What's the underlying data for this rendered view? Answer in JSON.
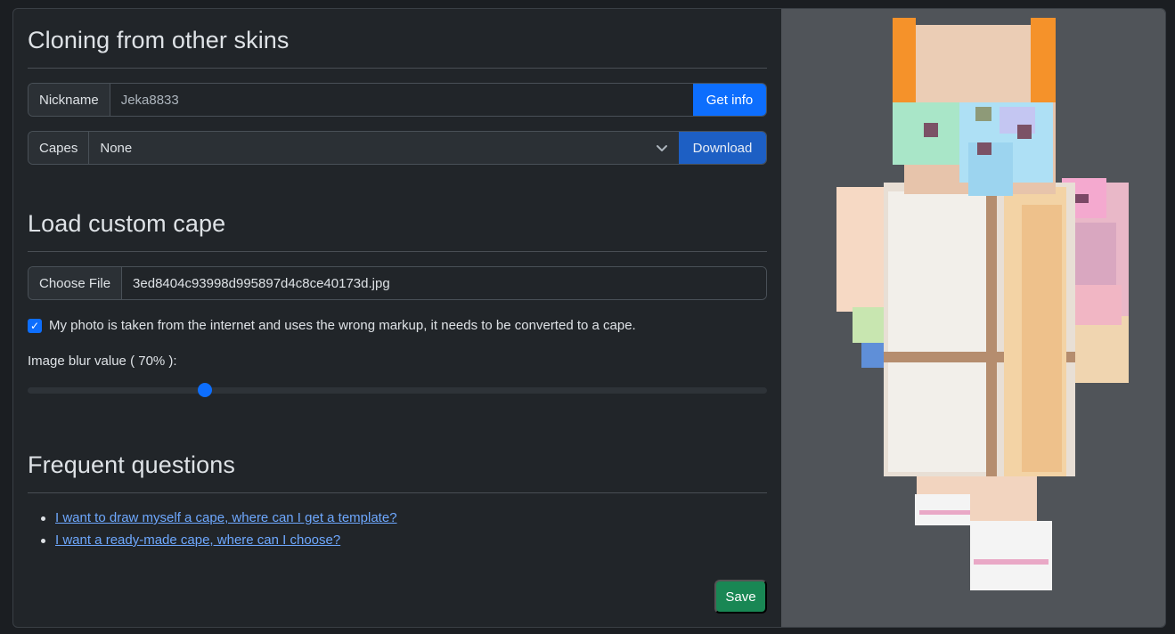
{
  "clone": {
    "heading": "Cloning from other skins",
    "nickname_label": "Nickname",
    "nickname_value": "Jeka8833",
    "get_info_label": "Get info",
    "capes_label": "Capes",
    "capes_selected": "None",
    "download_label": "Download"
  },
  "custom": {
    "heading": "Load custom cape",
    "choose_file_label": "Choose File",
    "file_name": "3ed8404c93998d995897d4c8ce40173d.jpg",
    "checkbox_label": "My photo is taken from the internet and uses the wrong markup, it needs to be converted to a cape.",
    "checkbox_checked": true,
    "blur_label": "Image blur value ( 70% ):",
    "blur_value_percent": 70,
    "blur_slider_position_fraction": 0.24
  },
  "faq": {
    "heading": "Frequent questions",
    "links": [
      "I want to draw myself a cape, where can I get a template?",
      "I want a ready-made cape, where can I choose?"
    ]
  },
  "save_label": "Save",
  "colors": {
    "primary": "#0d6efd",
    "success": "#198754",
    "preview_bg": "#505459"
  }
}
